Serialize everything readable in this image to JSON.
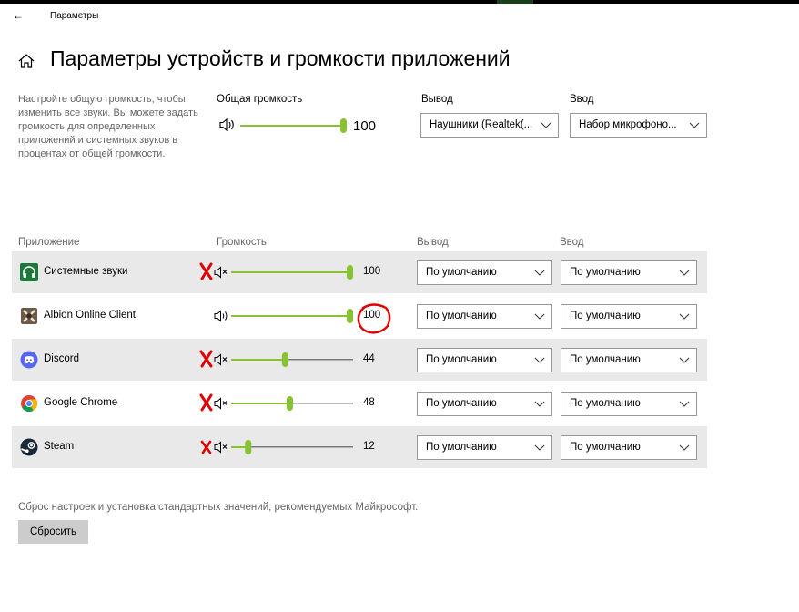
{
  "titlebar": {
    "back_icon": "arrow-left-icon",
    "app_title": "Параметры"
  },
  "page": {
    "home_icon": "home-icon",
    "title": "Параметры устройств и громкости приложений"
  },
  "master": {
    "description": "Настройте общую громкость, чтобы изменить все звуки. Вы можете задать громкость для определенных приложений и системных звуков в процентах от общей громкости.",
    "label": "Общая громкость",
    "value": 100,
    "value_text": "100",
    "output_label": "Вывод",
    "output_value": "Наушники (Realtek(...",
    "input_label": "Ввод",
    "input_value": "Набор микрофоно..."
  },
  "apps_header": {
    "app": "Приложение",
    "volume": "Громкость",
    "output": "Вывод",
    "input": "Ввод"
  },
  "apps": [
    {
      "name": "Системные звуки",
      "icon": "headphones-icon",
      "volume": 100,
      "volume_text": "100",
      "muted": true,
      "x_mark": true,
      "output": "По умолчанию",
      "input": "По умолчанию"
    },
    {
      "name": "Albion Online Client",
      "icon": "albion-icon",
      "volume": 100,
      "volume_text": "100",
      "muted": false,
      "x_mark": false,
      "output": "По умолчанию",
      "input": "По умолчанию"
    },
    {
      "name": "Discord",
      "icon": "discord-icon",
      "volume": 44,
      "volume_text": "44",
      "muted": true,
      "x_mark": true,
      "output": "По умолчанию",
      "input": "По умолчанию"
    },
    {
      "name": "Google Chrome",
      "icon": "chrome-icon",
      "volume": 48,
      "volume_text": "48",
      "muted": true,
      "x_mark": true,
      "output": "По умолчанию",
      "input": "По умолчанию"
    },
    {
      "name": "Steam",
      "icon": "steam-icon",
      "volume": 12,
      "volume_text": "12",
      "muted": true,
      "x_mark": true,
      "output": "По умолчанию",
      "input": "По умолчанию"
    }
  ],
  "reset": {
    "description": "Сброс настроек и установка стандартных значений, рекомендуемых Майкрософт.",
    "button_label": "Сбросить"
  },
  "colors": {
    "accent": "#86c232",
    "track": "#7a7a7a",
    "annotation": "#e00000"
  }
}
